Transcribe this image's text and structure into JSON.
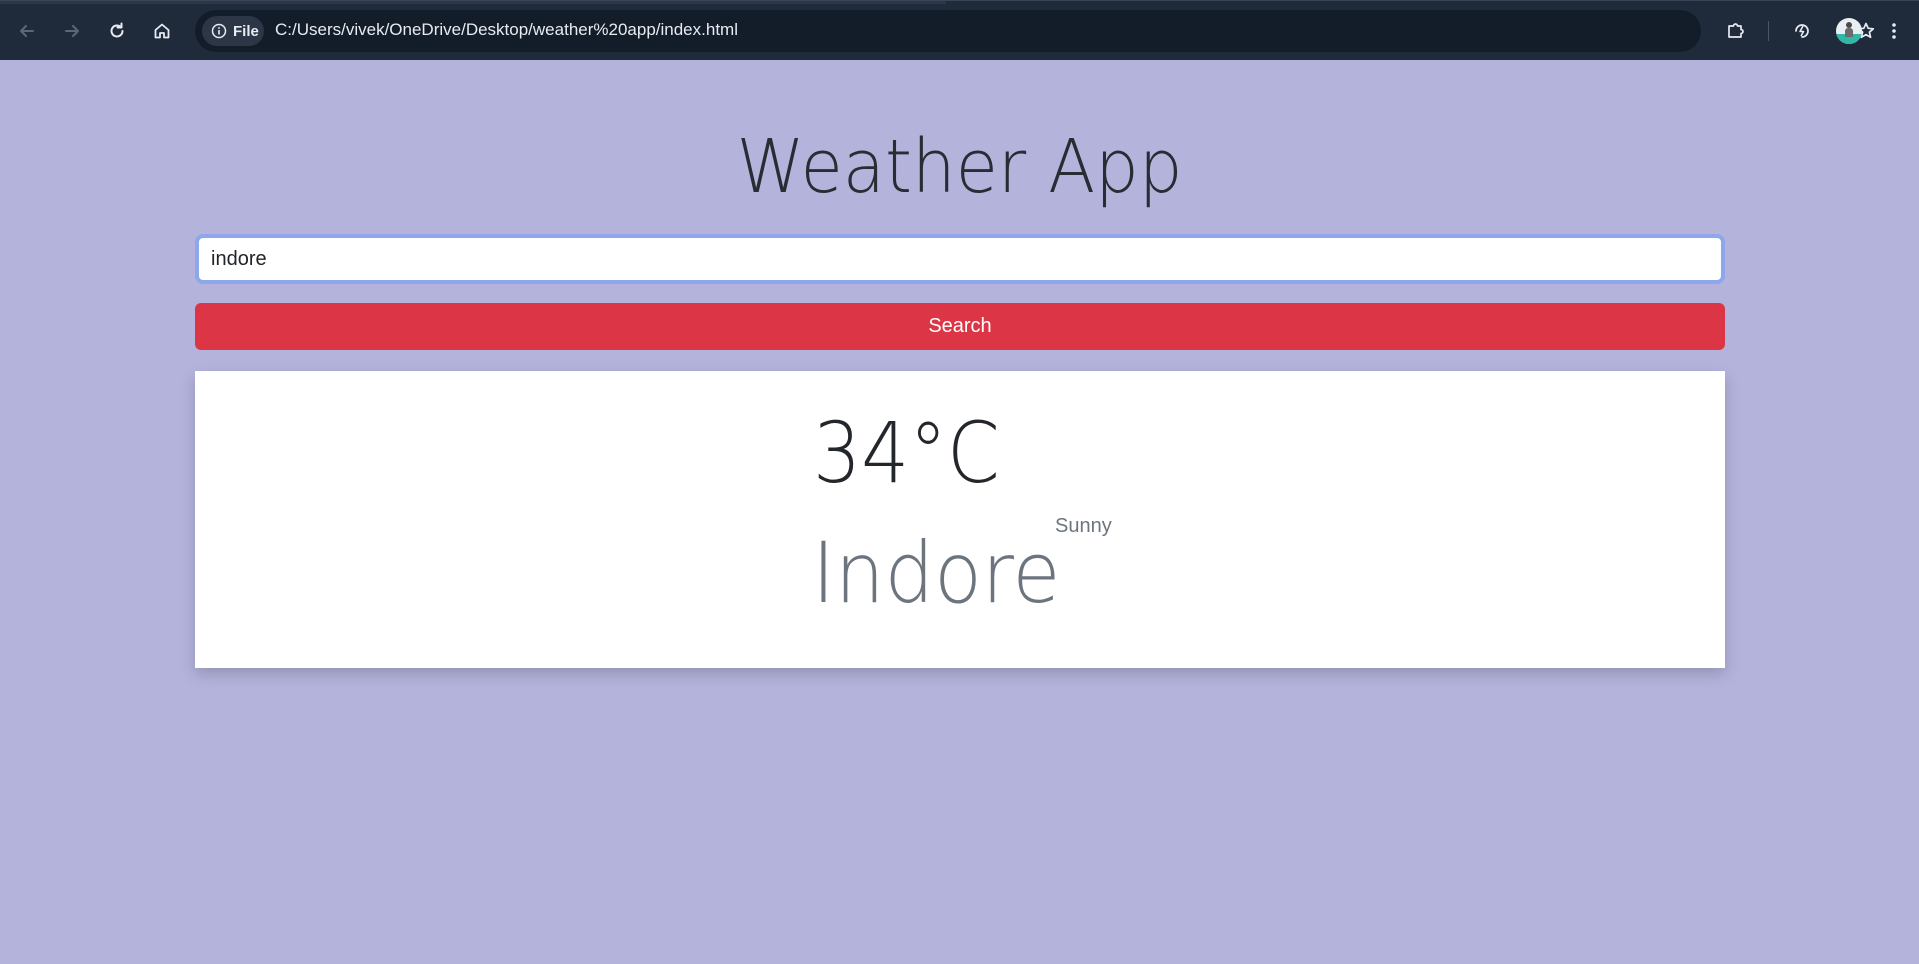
{
  "browser": {
    "site_chip_label": "File",
    "url": "C:/Users/vivek/OneDrive/Desktop/weather%20app/index.html"
  },
  "app": {
    "title": "Weather App",
    "search_value": "indore",
    "search_button_label": "Search"
  },
  "weather": {
    "temperature": "34°C",
    "condition": "Sunny",
    "city": "Indore"
  },
  "colors": {
    "page_background": "#b4b3dc",
    "search_button": "#dc3545",
    "input_focus_border": "#8ea6ec",
    "browser_chrome": "#1f2a3a"
  }
}
